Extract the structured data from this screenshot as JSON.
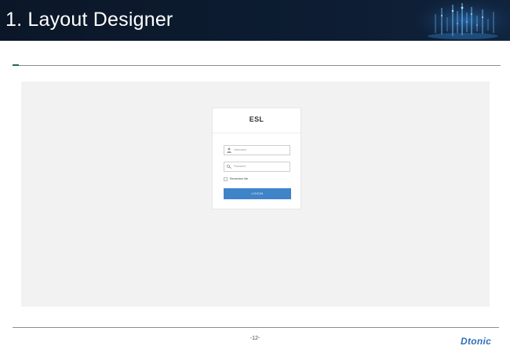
{
  "header": {
    "title": "1. Layout Designer"
  },
  "login": {
    "title": "ESL",
    "username_placeholder": "Username",
    "password_placeholder": "Password",
    "remember_label": "Remember Me",
    "login_button": "LOGIN"
  },
  "footer": {
    "page_number": "-12-",
    "brand": "Dtonic"
  },
  "colors": {
    "header_bg": "#0d1b2e",
    "accent": "#1f6b4a",
    "button": "#3f83c9",
    "brand": "#2f6fb8",
    "screen_bg": "#f2f2f2"
  }
}
